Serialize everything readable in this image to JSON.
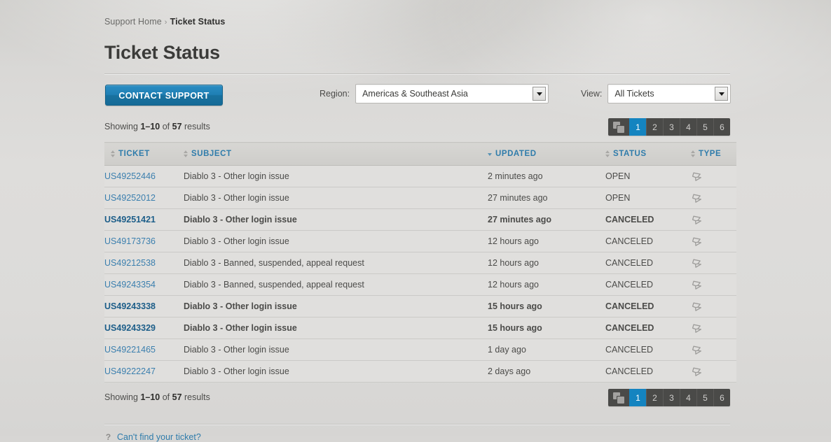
{
  "breadcrumb": {
    "home_label": "Support Home",
    "separator": "›",
    "current_label": "Ticket Status"
  },
  "page_title": "Ticket Status",
  "toolbar": {
    "contact_support_label": "CONTACT SUPPORT",
    "region_label": "Region:",
    "region_value": "Americas & Southeast Asia",
    "view_label": "View:",
    "view_value": "All Tickets"
  },
  "results": {
    "showing_prefix": "Showing ",
    "range": "1–10",
    "of_word": " of ",
    "total": "57",
    "suffix": " results"
  },
  "pagination": {
    "grid_icon": "pages-grid-icon",
    "pages": [
      "1",
      "2",
      "3",
      "4",
      "5",
      "6"
    ],
    "active_page": "1",
    "active_color": "#1484c0"
  },
  "table": {
    "columns": [
      {
        "key": "ticket",
        "label": "TICKET",
        "sorted": false,
        "sort_dir": "none"
      },
      {
        "key": "subject",
        "label": "SUBJECT",
        "sorted": false,
        "sort_dir": "none"
      },
      {
        "key": "updated",
        "label": "UPDATED",
        "sorted": true,
        "sort_dir": "desc"
      },
      {
        "key": "status",
        "label": "STATUS",
        "sorted": false,
        "sort_dir": "none"
      },
      {
        "key": "type",
        "label": "TYPE",
        "sorted": false,
        "sort_dir": "none"
      }
    ],
    "rows": [
      {
        "ticket": "US49252446",
        "subject": "Diablo 3 - Other login issue",
        "updated": "2 minutes ago",
        "status": "OPEN",
        "type_icon": "diablo3-game-icon",
        "unread": false
      },
      {
        "ticket": "US49252012",
        "subject": "Diablo 3 - Other login issue",
        "updated": "27 minutes ago",
        "status": "OPEN",
        "type_icon": "diablo3-game-icon",
        "unread": false
      },
      {
        "ticket": "US49251421",
        "subject": "Diablo 3 - Other login issue",
        "updated": "27 minutes ago",
        "status": "CANCELED",
        "type_icon": "diablo3-game-icon",
        "unread": true
      },
      {
        "ticket": "US49173736",
        "subject": "Diablo 3 - Other login issue",
        "updated": "12 hours ago",
        "status": "CANCELED",
        "type_icon": "diablo3-game-icon",
        "unread": false
      },
      {
        "ticket": "US49212538",
        "subject": "Diablo 3 - Banned, suspended, appeal request",
        "updated": "12 hours ago",
        "status": "CANCELED",
        "type_icon": "diablo3-game-icon",
        "unread": false
      },
      {
        "ticket": "US49243354",
        "subject": "Diablo 3 - Banned, suspended, appeal request",
        "updated": "12 hours ago",
        "status": "CANCELED",
        "type_icon": "diablo3-game-icon",
        "unread": false
      },
      {
        "ticket": "US49243338",
        "subject": "Diablo 3 - Other login issue",
        "updated": "15 hours ago",
        "status": "CANCELED",
        "type_icon": "diablo3-game-icon",
        "unread": true
      },
      {
        "ticket": "US49243329",
        "subject": "Diablo 3 - Other login issue",
        "updated": "15 hours ago",
        "status": "CANCELED",
        "type_icon": "diablo3-game-icon",
        "unread": true
      },
      {
        "ticket": "US49221465",
        "subject": "Diablo 3 - Other login issue",
        "updated": "1 day ago",
        "status": "CANCELED",
        "type_icon": "diablo3-game-icon",
        "unread": false
      },
      {
        "ticket": "US49222247",
        "subject": "Diablo 3 - Other login issue",
        "updated": "2 days ago",
        "status": "CANCELED",
        "type_icon": "diablo3-game-icon",
        "unread": false
      }
    ]
  },
  "footer": {
    "help_icon": "question-mark-icon",
    "cant_find_label": "Can't find your ticket?"
  }
}
